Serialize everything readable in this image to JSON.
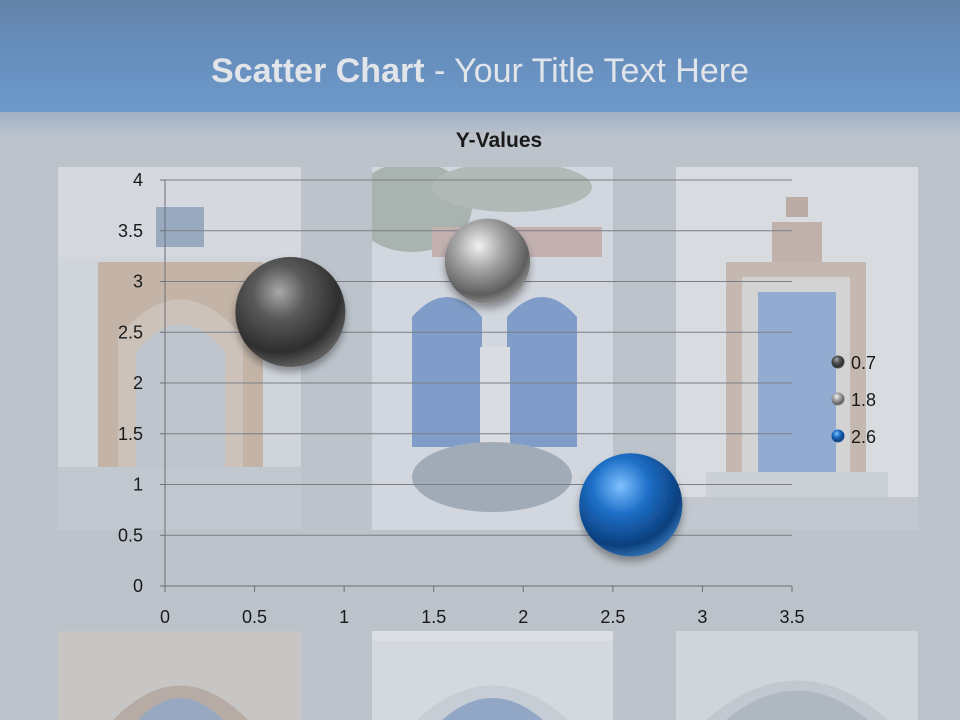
{
  "slide": {
    "title_bold": "Scatter Chart",
    "title_rest": " - Your Title Text Here"
  },
  "colors": {
    "header": "#2163b0",
    "background": "#bcc3cb",
    "series_dark": "#4a4a4a",
    "series_silver": "#8e8e8e",
    "series_blue": "#1a5faa"
  },
  "chart_data": {
    "type": "scatter",
    "title": "Y-Values",
    "xlim": [
      0,
      3.5
    ],
    "ylim": [
      0,
      4
    ],
    "x_ticks": [
      "0",
      "0.5",
      "1",
      "1.5",
      "2",
      "2.5",
      "3",
      "3.5"
    ],
    "y_ticks": [
      "0",
      "0.5",
      "1",
      "1.5",
      "2",
      "2.5",
      "3",
      "3.5",
      "4"
    ],
    "grid": true,
    "legend_position": "right",
    "series": [
      {
        "name": "0.7",
        "x": 0.7,
        "y": 2.7,
        "bubble_size": 1.0,
        "color": "dark-gray"
      },
      {
        "name": "1.8",
        "x": 1.8,
        "y": 3.2,
        "bubble_size": 0.6,
        "color": "silver"
      },
      {
        "name": "2.6",
        "x": 2.6,
        "y": 0.8,
        "bubble_size": 0.88,
        "color": "blue"
      }
    ]
  }
}
